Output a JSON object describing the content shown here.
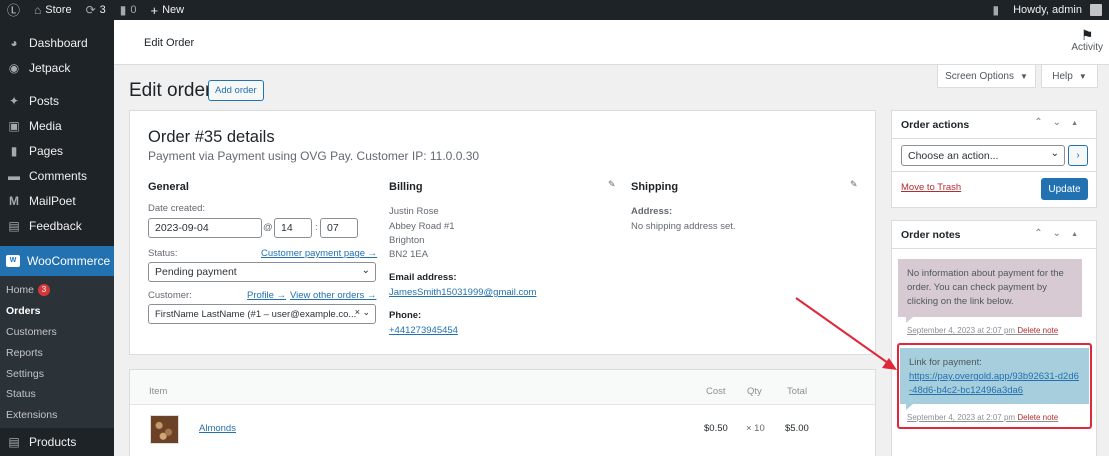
{
  "adminbar": {
    "site": "Store",
    "updates": "3",
    "comments": "0",
    "new": "New",
    "howdy": "Howdy, admin"
  },
  "sidebar": {
    "items": [
      {
        "label": "Dashboard",
        "icon": "dashboard-icon"
      },
      {
        "label": "Jetpack",
        "icon": "jetpack-icon"
      },
      {
        "label": "Posts",
        "icon": "pin-icon"
      },
      {
        "label": "Media",
        "icon": "media-icon"
      },
      {
        "label": "Pages",
        "icon": "page-icon"
      },
      {
        "label": "Comments",
        "icon": "comment-icon"
      },
      {
        "label": "MailPoet",
        "icon": "mailpoet-icon"
      },
      {
        "label": "Feedback",
        "icon": "feedback-icon"
      }
    ],
    "woocommerce": "WooCommerce",
    "submenu": [
      {
        "label": "Home",
        "badge": "3"
      },
      {
        "label": "Orders"
      },
      {
        "label": "Customers"
      },
      {
        "label": "Reports"
      },
      {
        "label": "Settings"
      },
      {
        "label": "Status"
      },
      {
        "label": "Extensions"
      }
    ],
    "products": "Products"
  },
  "header": {
    "title": "Edit Order",
    "activity": "Activity",
    "screen_options": "Screen Options",
    "help": "Help"
  },
  "page": {
    "title": "Edit order",
    "add_order": "Add order"
  },
  "order": {
    "heading": "Order #35 details",
    "subheading": "Payment via Payment using OVG Pay. Customer IP: 11.0.0.30",
    "general": {
      "title": "General",
      "date_label": "Date created:",
      "date": "2023-09-04",
      "hour": "14",
      "minute": "07",
      "status_label": "Status:",
      "customer_payment_link": "Customer payment page →",
      "status": "Pending payment",
      "customer_label": "Customer:",
      "profile_link": "Profile →",
      "other_orders_link": "View other orders →",
      "customer": "FirstName LastName (#1 – user@example.co..."
    },
    "billing": {
      "title": "Billing",
      "lines": [
        "Justin Rose",
        "Abbey Road #1",
        "Brighton",
        "BN2 1EA"
      ],
      "email_label": "Email address:",
      "email": "JamesSmith15031999@gmail.com",
      "phone_label": "Phone:",
      "phone": "+441273945454"
    },
    "shipping": {
      "title": "Shipping",
      "address_label": "Address:",
      "address": "No shipping address set."
    }
  },
  "items": {
    "headers": {
      "item": "Item",
      "cost": "Cost",
      "qty": "Qty",
      "total": "Total"
    },
    "rows": [
      {
        "name": "Almonds",
        "cost": "$0.50",
        "qty": "× 10",
        "total": "$5.00"
      }
    ]
  },
  "order_actions": {
    "title": "Order actions",
    "select": "Choose an action...",
    "trash": "Move to Trash",
    "update": "Update"
  },
  "order_notes": {
    "title": "Order notes",
    "notes": [
      {
        "text": "No information about payment for the order. You can check payment by clicking on the link below.",
        "meta": "September 4, 2023 at 2:07 pm",
        "delete": "Delete note"
      },
      {
        "label": "Link for payment:",
        "link": "https://pay.overgold.app/93b92631-d2d6-48d6-b4c2-bc12496a3da6",
        "meta": "September 4, 2023 at 2:07 pm",
        "delete": "Delete note"
      }
    ]
  },
  "colors": {
    "accent": "#2271b1",
    "highlight": "#e0283a",
    "note_private": "#d7cad2",
    "note_system": "#a7cedc"
  }
}
